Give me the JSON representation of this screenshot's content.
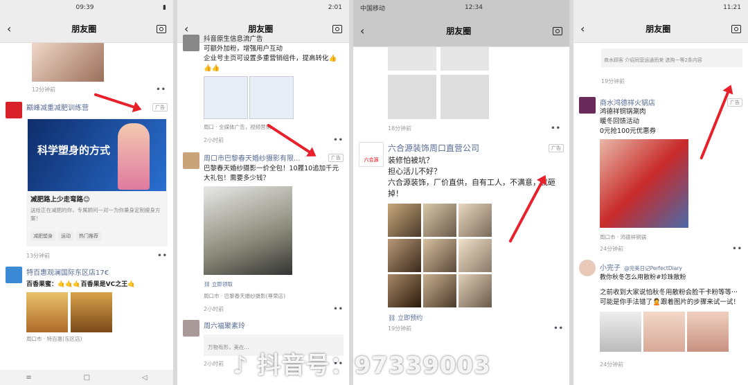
{
  "screen_title": "朋友圈",
  "p1": {
    "status_time": "09:39",
    "post_a_time": "12分钟前",
    "ad": {
      "name": "巅峰减重减肥训练营",
      "ad_label": "广告",
      "banner_text": "科学塑身的方式",
      "headline": "减肥路上少走弯路😊",
      "desc": "送给正在减肥的你，专属顾问一对一为你量身定制瘦身方案！",
      "tags": [
        "减肥塑身",
        "运动",
        "热门推荐"
      ],
      "time": "13分钟前"
    },
    "post_b": {
      "name": "特百惠观澜国际东区店17€",
      "text": "百香果蜜：🤙🤙🤙百香果是VC之王🤙",
      "location": "周口市 · 特百惠(东区店)"
    }
  },
  "p2": {
    "status_time": "2:01",
    "post_a": {
      "text": "抖音原生信息流广告\n可额外加粉，增强用户互动\n企业号主页可设置多重营销组件，提高转化👍👍👍",
      "location": "周口 · 全媒体广告，视频营销",
      "time": "2小时前"
    },
    "ad": {
      "name": "周口市巴黎春天婚纱摄影有限...",
      "ad_label": "广告",
      "text": "巴黎春天婚纱摄影一价全包！10履10追加千元大礼包！需要多少钱？",
      "cta": "立即领取",
      "location": "周口市 · 巴黎春天婚纱摄影(尊荣店)",
      "time": "2小时前"
    },
    "post_c": {
      "name": "周六福聚素玲",
      "text": "万物有形，美在...",
      "time": "2小时前"
    }
  },
  "p3": {
    "carrier": "中国移动",
    "status_time": "12:34",
    "post_a_time": "18分钟前",
    "ad": {
      "name": "六合源装饰周口直营公司",
      "ad_label": "广告",
      "logo_text": "六合源",
      "text": "装修怕被坑？\n担心活儿不好？\n六合源装饰，厂价直供，自有工人，不满意，就砸掉！",
      "cta": "立即预约",
      "time": "19分钟前"
    }
  },
  "p4": {
    "status_time": "11:21",
    "top_text": "商水顾客 介绍同营运通而来 选购一等2条内容",
    "post_a_time": "19分钟前",
    "ad": {
      "name": "商水鸿德祥火锅店",
      "ad_label": "广告",
      "text": "鸿德祥铜锅涮肉\n暖冬回馈活动\n0元抢100元优惠券",
      "location": "周口市 · 鸿德祥铜锅",
      "time": "24分钟前"
    },
    "post_b": {
      "name": "小完子",
      "handle": "@完美日记PerfectDiary",
      "caption": "教你秋冬怎么用散粉#珍珠散粉",
      "text": "之前收到大家说怕秋冬用散粉会脸干卡粉等等···可能是你手法错了🙎跟着图片的步骤来试一试！",
      "time": "24分钟前"
    }
  },
  "watermark": "抖音号：97339003"
}
